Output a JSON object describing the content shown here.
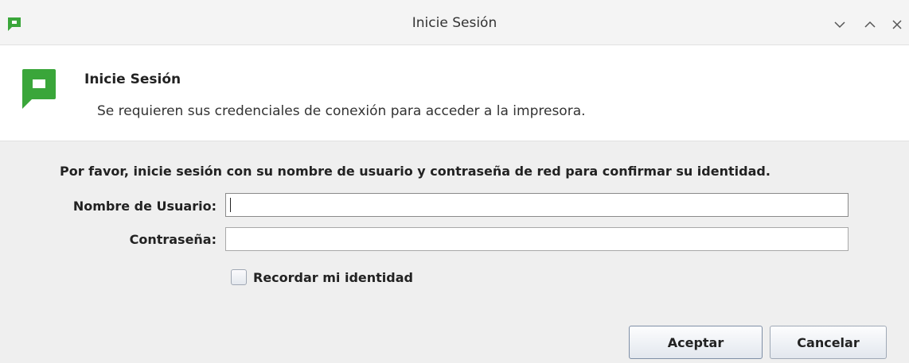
{
  "window": {
    "title": "Inicie Sesión",
    "brand_color": "#3aa63a"
  },
  "header": {
    "title": "Inicie Sesión",
    "subtitle": "Se requieren sus credenciales de conexión para acceder a la impresora."
  },
  "form": {
    "instructions": "Por favor, inicie sesión con su nombre de usuario y contraseña de red para confirmar su identidad.",
    "username_label": "Nombre de Usuario:",
    "username_value": "",
    "password_label": "Contraseña:",
    "password_value": "",
    "remember_label": "Recordar mi identidad",
    "remember_checked": false
  },
  "buttons": {
    "ok_label": "Aceptar",
    "cancel_label": "Cancelar"
  },
  "icons": {
    "app": "papercut-logo-icon",
    "minimize": "chevron-down-icon",
    "maximize": "chevron-up-icon",
    "close": "close-icon"
  }
}
